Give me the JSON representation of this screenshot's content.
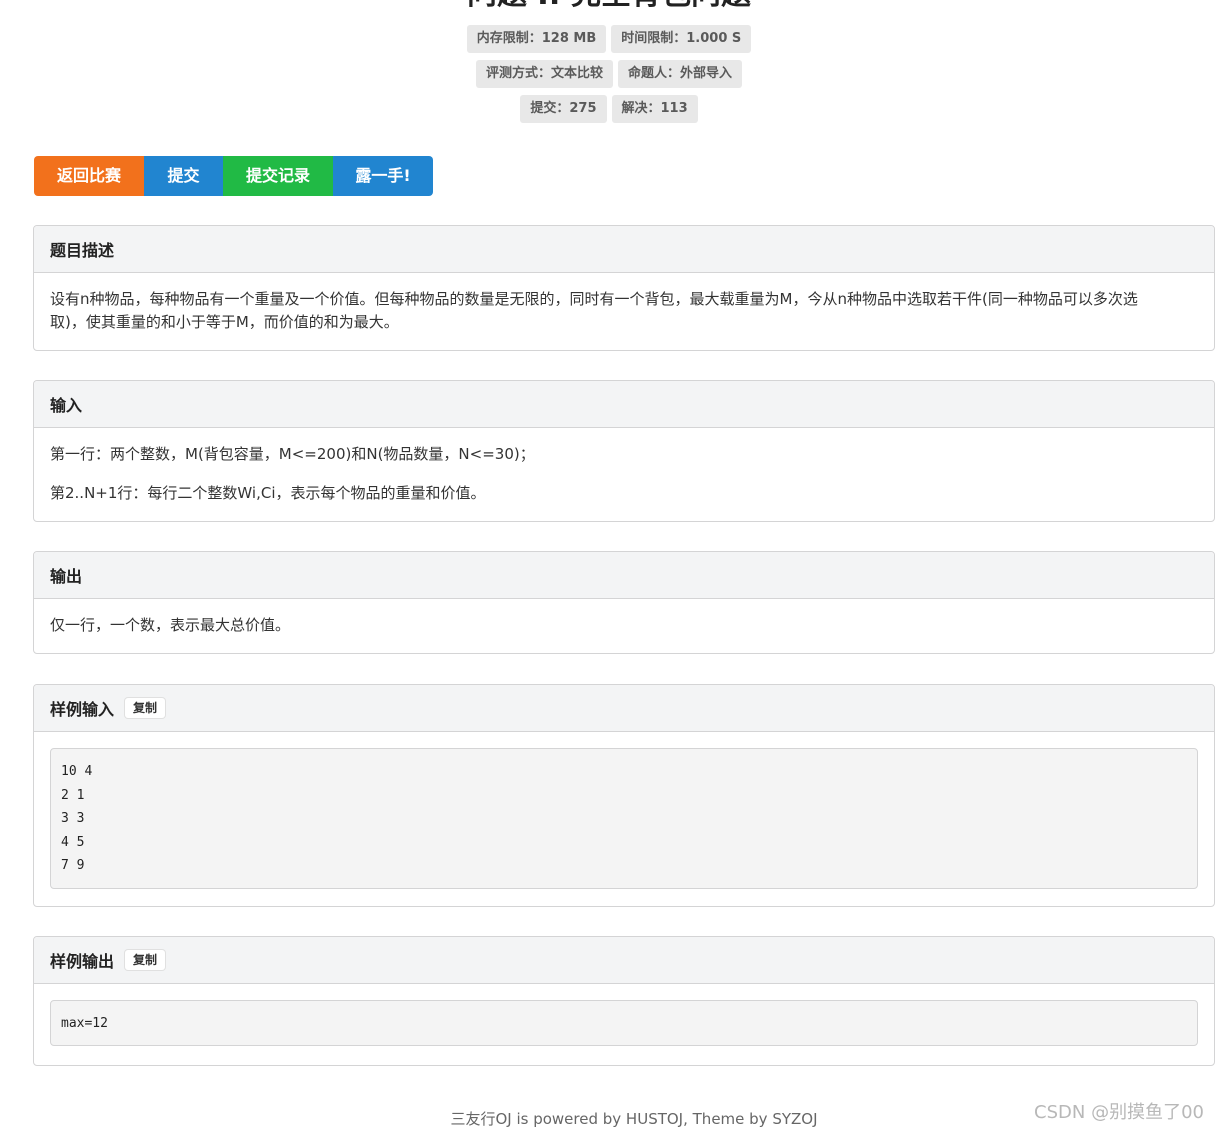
{
  "problem": {
    "title": "问题 I: 完全背包问题"
  },
  "labels": {
    "memory_limit": "内存限制：128 MB",
    "time_limit": "时间限制：1.000 S",
    "judge_method": "评测方式：文本比较",
    "author": "命题人：外部导入",
    "submitted": "提交：275",
    "solved": "解决：113"
  },
  "buttons": {
    "back_contest": "返回比赛",
    "submit": "提交",
    "submit_records": "提交记录",
    "show_off": "露一手!"
  },
  "description": {
    "header": "题目描述",
    "line1": "设有n种物品，每种物品有一个重量及一个价值。但每种物品的数量是无限的，同时有一个背包，最大载重量为M，今从n种物品中选取若干件(同一种物品可以多次选",
    "line2": "取)，使其重量的和小于等于M，而价值的和为最大。"
  },
  "input": {
    "header": "输入",
    "line1": "第一行：两个整数，M(背包容量，M<=200)和N(物品数量，N<=30)；",
    "line2": "第2..N+1行：每行二个整数Wi,Ci，表示每个物品的重量和价值。"
  },
  "output": {
    "header": "输出",
    "line1": "仅一行，一个数，表示最大总价值。"
  },
  "sample_input": {
    "header": "样例输入",
    "copy_label": "复制",
    "lines": [
      "10 4",
      "2 1",
      "3 3",
      "4 5",
      "7 9"
    ]
  },
  "sample_output": {
    "header": "样例输出",
    "copy_label": "复制",
    "lines": [
      "max=12"
    ]
  },
  "footer": {
    "text": "三友行OJ is powered by HUSTOJ, Theme by SYZOJ"
  },
  "watermark": {
    "text": "CSDN @别摸鱼了00"
  },
  "colors": {
    "orange": "#f2711c",
    "blue": "#2185d0",
    "green": "#21ba45"
  }
}
